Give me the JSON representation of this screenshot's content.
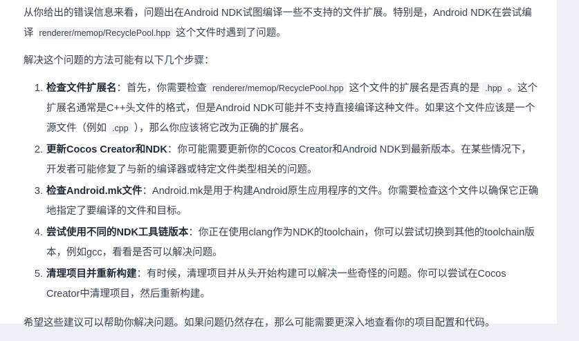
{
  "intro": {
    "p1_a": "从你给出的错误信息来看，问题出在Android NDK试图编译一些不支持的文件扩展。特别是，Android NDK在尝试编译",
    "p1_code": "renderer/memop/RecyclePool.hpp",
    "p1_b": "这个文件时遇到了问题。",
    "p2": "解决这个问题的方法可能有以下几个步骤："
  },
  "steps": [
    {
      "title": "检查文件扩展名",
      "a": "：首先，你需要检查",
      "code1": "renderer/memop/RecyclePool.hpp",
      "b": "这个文件的扩展名是否真的是",
      "code2": ".hpp",
      "c": "。这个扩展名通常是C++头文件的格式，但是Android NDK可能并不支持直接编译这种文件。如果这个文件应该是一个源文件（例如",
      "code3": ".cpp",
      "d": "），那么你应该将它改为正确的扩展名。"
    },
    {
      "title": "更新Cocos Creator和NDK",
      "text": "：你可能需要更新你的Cocos Creator和Android NDK到最新版本。在某些情况下，开发者可能修复了与新的编译器或特定文件类型相关的问题。"
    },
    {
      "title": "检查Android.mk文件",
      "text": "：Android.mk是用于构建Android原生应用程序的文件。你需要检查这个文件以确保它正确地指定了要编译的文件和目标。"
    },
    {
      "title": "尝试使用不同的NDK工具链版本",
      "text": "：你正在使用clang作为NDK的toolchain，你可以尝试切换到其他的toolchain版本，例如gcc，看看是否可以解决问题。"
    },
    {
      "title": "清理项目并重新构建",
      "text": "：有时候，清理项目并从头开始构建可以解决一些奇怪的问题。你可以尝试在Cocos Creator中清理项目，然后重新构建。"
    }
  ],
  "closing": "希望这些建议可以帮助你解决问题。如果问题仍然存在，那么可能需要更深入地查看你的项目配置和代码。"
}
